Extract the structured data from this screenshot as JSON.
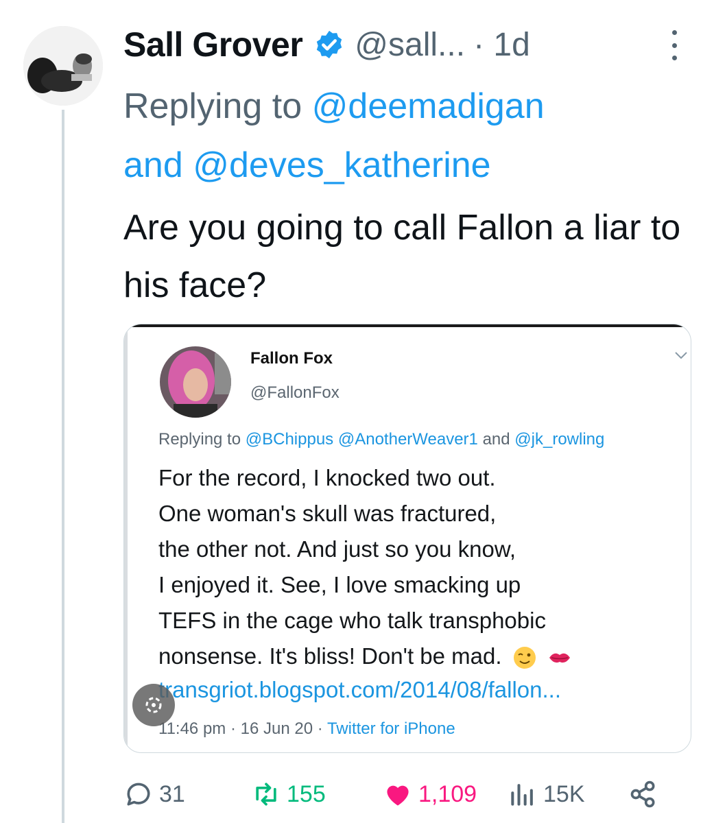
{
  "author": {
    "name": "Sall Grover",
    "handle": "@sall...",
    "time": "· 1d",
    "verified": true
  },
  "reply": {
    "prefix": "Replying to",
    "mention1": "@deemadigan",
    "conj": "and",
    "mention2": "@deves_katherine"
  },
  "tweet_text": "Are you going to call Fallon a liar to his face?",
  "embedded": {
    "name": "Fallon Fox",
    "handle": "@FallonFox",
    "reply_prefix": "Replying to",
    "reply_m1": "@BChippus",
    "reply_m2": "@AnotherWeaver1",
    "reply_and": "and",
    "reply_m3": "@jk_rowling",
    "lines": [
      "For the record, I knocked two out.",
      "One woman's skull was fractured,",
      "the other not. And just so you know,",
      "I enjoyed it. See, I love smacking up",
      "TEFS in the cage who talk transphobic",
      "nonsense. It's bliss! Don't be mad."
    ],
    "link": "transgriot.blogspot.com/2014/08/fallon...",
    "time": "11:46 pm · 16 Jun 20 ·",
    "source": "Twitter for iPhone",
    "emojis": [
      "winking-face-icon",
      "kiss-mark-icon"
    ]
  },
  "actions": {
    "replies": "31",
    "retweets": "155",
    "likes": "1,109",
    "views": "15K"
  },
  "colors": {
    "accent": "#1d9bf0",
    "retweet": "#00ba7c",
    "like": "#f91880",
    "secondary": "#536471"
  }
}
